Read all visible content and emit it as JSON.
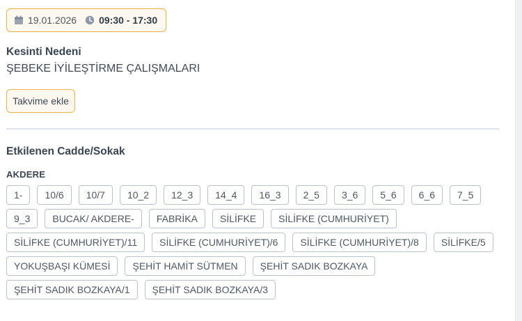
{
  "schedule": {
    "date": "19.01.2026",
    "time_range": "09:30 - 17:30",
    "date_icon": "calendar-icon",
    "time_icon": "clock-icon"
  },
  "reason": {
    "label": "Kesinti Nedeni",
    "value": "ŞEBEKE İYİLEŞTİRME ÇALIŞMALARI"
  },
  "actions": {
    "add_to_calendar": "Takvime ekle"
  },
  "affected": {
    "label": "Etkilenen Cadde/Sokak",
    "district": "AKDERE",
    "streets": [
      "1-",
      "10/6",
      "10/7",
      "10_2",
      "12_3",
      "14_4",
      "16_3",
      "2_5",
      "3_6",
      "5_6",
      "6_6",
      "7_5",
      "9_3",
      "BUCAK/ AKDERE-",
      "FABRİKA",
      "SİLİFKE",
      "SİLİFKE (CUMHURİYET)",
      "SİLİFKE (CUMHURİYET)/11",
      "SİLİFKE (CUMHURİYET)/6",
      "SİLİFKE (CUMHURİYET)/8",
      "SİLİFKE/5",
      "YOKUŞBAŞI KÜMESİ",
      "ŞEHİT HAMİT SÜTMEN",
      "ŞEHİT SADIK BOZKAYA",
      "ŞEHİT SADIK BOZKAYA/1",
      "ŞEHİT SADIK BOZKAYA/3"
    ]
  },
  "colors": {
    "accent_border": "#f0b34a",
    "accent_background": "#fdf8ef",
    "chip_border": "#b9c3cf",
    "text": "#3f4a59"
  }
}
